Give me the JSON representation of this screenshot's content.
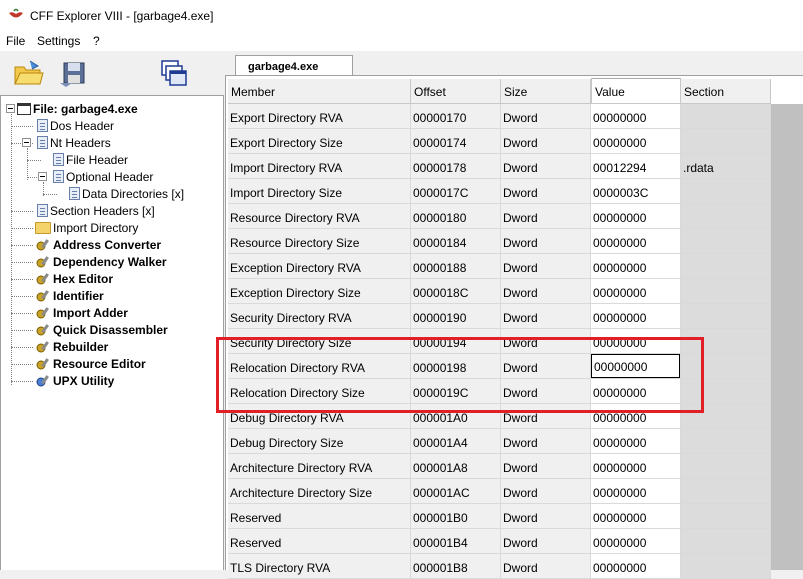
{
  "window": {
    "title": "CFF Explorer VIII - [garbage4.exe]"
  },
  "menu": {
    "items": [
      "File",
      "Settings",
      "?"
    ]
  },
  "tabs": [
    {
      "label": "garbage4.exe"
    }
  ],
  "tree": {
    "root": "File: garbage4.exe",
    "items": [
      {
        "label": "Dos Header",
        "level": 2,
        "icon": "doc"
      },
      {
        "label": "Nt Headers",
        "level": 2,
        "icon": "doc"
      },
      {
        "label": "File Header",
        "level": 3,
        "icon": "doc"
      },
      {
        "label": "Optional Header",
        "level": 3,
        "icon": "doc"
      },
      {
        "label": "Data Directories [x]",
        "level": 4,
        "icon": "doc"
      },
      {
        "label": "Section Headers [x]",
        "level": 2,
        "icon": "doc"
      },
      {
        "label": "Import Directory",
        "level": 2,
        "icon": "folder"
      },
      {
        "label": "Address Converter",
        "level": 2,
        "icon": "tool"
      },
      {
        "label": "Dependency Walker",
        "level": 2,
        "icon": "tool"
      },
      {
        "label": "Hex Editor",
        "level": 2,
        "icon": "tool"
      },
      {
        "label": "Identifier",
        "level": 2,
        "icon": "tool"
      },
      {
        "label": "Import Adder",
        "level": 2,
        "icon": "tool"
      },
      {
        "label": "Quick Disassembler",
        "level": 2,
        "icon": "tool"
      },
      {
        "label": "Rebuilder",
        "level": 2,
        "icon": "tool"
      },
      {
        "label": "Resource Editor",
        "level": 2,
        "icon": "tool"
      },
      {
        "label": "UPX Utility",
        "level": 2,
        "icon": "tool"
      }
    ]
  },
  "table": {
    "columns": [
      "Member",
      "Offset",
      "Size",
      "Value",
      "Section"
    ],
    "rows": [
      {
        "member": "Export Directory RVA",
        "offset": "00000170",
        "size": "Dword",
        "value": "00000000",
        "section": ""
      },
      {
        "member": "Export Directory Size",
        "offset": "00000174",
        "size": "Dword",
        "value": "00000000",
        "section": ""
      },
      {
        "member": "Import Directory RVA",
        "offset": "00000178",
        "size": "Dword",
        "value": "00012294",
        "section": ".rdata"
      },
      {
        "member": "Import Directory Size",
        "offset": "0000017C",
        "size": "Dword",
        "value": "0000003C",
        "section": ""
      },
      {
        "member": "Resource Directory RVA",
        "offset": "00000180",
        "size": "Dword",
        "value": "00000000",
        "section": ""
      },
      {
        "member": "Resource Directory Size",
        "offset": "00000184",
        "size": "Dword",
        "value": "00000000",
        "section": ""
      },
      {
        "member": "Exception Directory RVA",
        "offset": "00000188",
        "size": "Dword",
        "value": "00000000",
        "section": ""
      },
      {
        "member": "Exception Directory Size",
        "offset": "0000018C",
        "size": "Dword",
        "value": "00000000",
        "section": ""
      },
      {
        "member": "Security Directory RVA",
        "offset": "00000190",
        "size": "Dword",
        "value": "00000000",
        "section": ""
      },
      {
        "member": "Security Directory Size",
        "offset": "00000194",
        "size": "Dword",
        "value": "00000000",
        "section": ""
      },
      {
        "member": "Relocation Directory RVA",
        "offset": "00000198",
        "size": "Dword",
        "value": "00000000",
        "section": ""
      },
      {
        "member": "Relocation Directory Size",
        "offset": "0000019C",
        "size": "Dword",
        "value": "00000000",
        "section": ""
      },
      {
        "member": "Debug Directory RVA",
        "offset": "000001A0",
        "size": "Dword",
        "value": "00000000",
        "section": ""
      },
      {
        "member": "Debug Directory Size",
        "offset": "000001A4",
        "size": "Dword",
        "value": "00000000",
        "section": ""
      },
      {
        "member": "Architecture Directory RVA",
        "offset": "000001A8",
        "size": "Dword",
        "value": "00000000",
        "section": ""
      },
      {
        "member": "Architecture Directory Size",
        "offset": "000001AC",
        "size": "Dword",
        "value": "00000000",
        "section": ""
      },
      {
        "member": "Reserved",
        "offset": "000001B0",
        "size": "Dword",
        "value": "00000000",
        "section": ""
      },
      {
        "member": "Reserved",
        "offset": "000001B4",
        "size": "Dword",
        "value": "00000000",
        "section": ""
      },
      {
        "member": "TLS Directory RVA",
        "offset": "000001B8",
        "size": "Dword",
        "value": "00000000",
        "section": ""
      }
    ],
    "selected_row": 10
  },
  "colors": {
    "highlight": "#e21f26",
    "section_col": "#dcdcdc"
  }
}
